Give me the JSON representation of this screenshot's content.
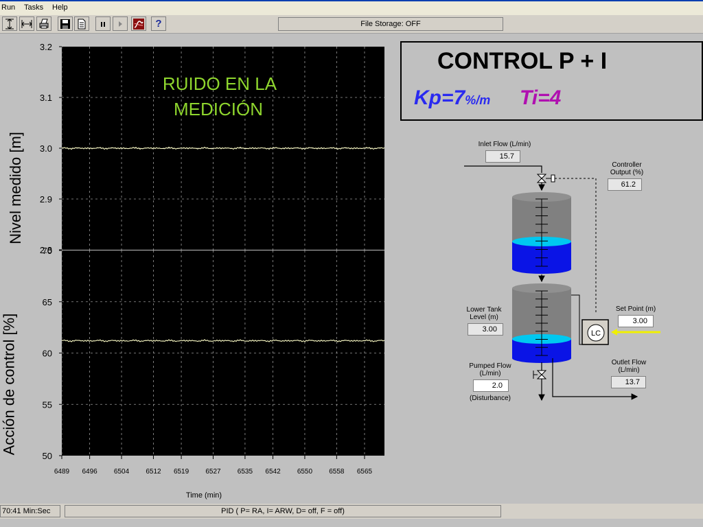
{
  "menu": {
    "items": [
      "Run",
      "Tasks",
      "Help"
    ]
  },
  "toolbar": {
    "buttons": [
      "vertical-resize-icon",
      "horizontal-resize-icon",
      "print-icon",
      "save-icon",
      "document-icon",
      "pause-icon",
      "play-icon",
      "trend-icon",
      "help-icon"
    ],
    "help_label": "?"
  },
  "file_storage": "File Storage:  OFF",
  "colors": {
    "background": "#c0c0c0",
    "chart_bg": "#000000",
    "trace": "#ffffc8",
    "annotation": "#8fd62e",
    "kp": "#2a2af0",
    "ti": "#b010b0",
    "water_top": "#00c8f0",
    "water": "#0a14e6",
    "setpoint_arrow": "#f0f000"
  },
  "charts": {
    "level_ylabel": "Nivel medido [m]",
    "action_ylabel": "Acción de control  [%]",
    "xlabel": "Time (min)",
    "annotation": [
      "RUIDO EN LA",
      "MEDICIÓN"
    ]
  },
  "chart_data": [
    {
      "type": "line",
      "title": "",
      "ylabel": "Nivel medido [m]",
      "xlabel": "",
      "xlim": [
        6489,
        6570
      ],
      "ylim": [
        2.8,
        3.2
      ],
      "yticks": [
        "3.2",
        "3.1",
        "3.0",
        "2.9",
        "2.8"
      ],
      "grid": true,
      "series": [
        {
          "x": [
            6489,
            6570
          ],
          "values": [
            3.0,
            3.0
          ]
        }
      ]
    },
    {
      "type": "line",
      "title": "",
      "ylabel": "Acción de control  [%]",
      "xlabel": "Time (min)",
      "xlim": [
        6489,
        6570
      ],
      "ylim": [
        50,
        70
      ],
      "yticks": [
        "70",
        "65",
        "60",
        "55",
        "50"
      ],
      "xticks": [
        "6489",
        "6496",
        "6504",
        "6512",
        "6519",
        "6527",
        "6535",
        "6542",
        "6550",
        "6558",
        "6565"
      ],
      "xtick_values": [
        6489,
        6496,
        6504,
        6512,
        6519,
        6527,
        6535,
        6542,
        6550,
        6558,
        6565
      ],
      "grid": true,
      "series": [
        {
          "x": [
            6489,
            6570
          ],
          "values": [
            61.2,
            61.2
          ]
        }
      ]
    }
  ],
  "control": {
    "title": "CONTROL P + I",
    "kp": "Kp=7",
    "kp_unit": "%/m",
    "ti": "Ti=4"
  },
  "process": {
    "inlet_label": "Inlet Flow  (L/min)",
    "inlet_value": "15.7",
    "controller_label_1": "Controller",
    "controller_label_2": "Output  (%)",
    "controller_value": "61.2",
    "setpoint_label": "Set Point  (m)",
    "setpoint_value": "3.00",
    "lower_label_1": "Lower Tank",
    "lower_label_2": "Level  (m)",
    "lower_value": "3.00",
    "pumped_label_1": "Pumped Flow",
    "pumped_label_2": "(L/min)",
    "pumped_value": "2.0",
    "disturbance_label": "(Disturbance)",
    "outlet_label_1": "Outlet Flow",
    "outlet_label_2": "(L/min)",
    "outlet_value": "13.7",
    "lc_label": "LC"
  },
  "status": {
    "time": "70:41  Min:Sec",
    "mode": "PID ( P= RA, I= ARW, D= off, F = off)"
  }
}
